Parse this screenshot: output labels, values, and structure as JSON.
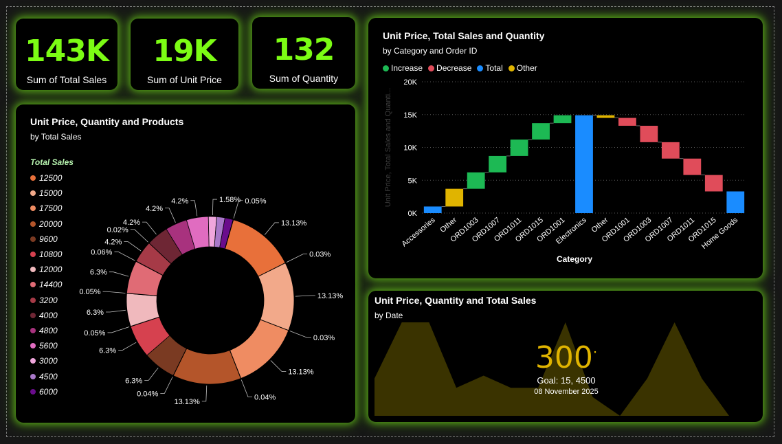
{
  "kpis": [
    {
      "value": "143K",
      "label": "Sum of Total Sales"
    },
    {
      "value": "19K",
      "label": "Sum of Unit Price"
    },
    {
      "value": "132",
      "label": "Sum of Quantity"
    }
  ],
  "colors": {
    "kpi_value": "#7cfc14",
    "glow": "#7cfc14",
    "increase": "#1db954",
    "decrease": "#e04c5a",
    "total": "#1a8cff",
    "other": "#e0b400"
  },
  "donut": {
    "title": "Unit Price, Quantity and Products",
    "subtitle": "by Total Sales",
    "legend_title": "Total Sales"
  },
  "waterfall": {
    "title": "Unit Price, Total Sales and Quantity",
    "subtitle": "by Category and Order ID",
    "legend": [
      {
        "name": "Increase",
        "color": "#1db954"
      },
      {
        "name": "Decrease",
        "color": "#e04c5a"
      },
      {
        "name": "Total",
        "color": "#1a8cff"
      },
      {
        "name": "Other",
        "color": "#e0b400"
      }
    ]
  },
  "area_card": {
    "title": "Unit Price, Quantity and Total Sales",
    "subtitle": "by Date",
    "gauge_value": "300",
    "goal_text": "Goal: 15, 4500",
    "date_text": "08 November 2025"
  },
  "chart_data": [
    {
      "type": "pie",
      "variant": "donut",
      "legend_title": "Total Sales",
      "legend_placement": "left",
      "legend_entries": [
        {
          "label": "12500",
          "color": "#e8703a"
        },
        {
          "label": "15000",
          "color": "#f2a98a"
        },
        {
          "label": "17500",
          "color": "#ef8c62"
        },
        {
          "label": "20000",
          "color": "#b4552a"
        },
        {
          "label": "9600",
          "color": "#7a3a22"
        },
        {
          "label": "10800",
          "color": "#d6414f"
        },
        {
          "label": "12000",
          "color": "#f0b9bd"
        },
        {
          "label": "14400",
          "color": "#e06b75"
        },
        {
          "label": "3200",
          "color": "#a63a47"
        },
        {
          "label": "4000",
          "color": "#6e2634"
        },
        {
          "label": "4800",
          "color": "#a8327e"
        },
        {
          "label": "5600",
          "color": "#e06cc0"
        },
        {
          "label": "3000",
          "color": "#f0a6dc"
        },
        {
          "label": "4500",
          "color": "#a878c8"
        },
        {
          "label": "6000",
          "color": "#6a0c8c"
        }
      ],
      "slices": [
        {
          "category": "12500",
          "value": 13.13,
          "label": "13.13%",
          "color": "#e8703a"
        },
        {
          "category": "12500",
          "value": 0.03,
          "label": "0.03%",
          "color": "#e8703a"
        },
        {
          "category": "15000",
          "value": 13.13,
          "label": "13.13%",
          "color": "#f2a98a"
        },
        {
          "category": "15000",
          "value": 0.03,
          "label": "0.03%",
          "color": "#f2a98a"
        },
        {
          "category": "17500",
          "value": 13.13,
          "label": "13.13%",
          "color": "#ef8c62"
        },
        {
          "category": "17500",
          "value": 0.04,
          "label": "0.04%",
          "color": "#ef8c62"
        },
        {
          "category": "20000",
          "value": 13.13,
          "label": "13.13%",
          "color": "#b4552a"
        },
        {
          "category": "20000",
          "value": 0.04,
          "label": "0.04%",
          "color": "#b4552a"
        },
        {
          "category": "9600",
          "value": 6.3,
          "label": "6.3%",
          "color": "#7a3a22"
        },
        {
          "category": "10800",
          "value": 6.3,
          "label": "6.3%",
          "color": "#d6414f"
        },
        {
          "category": "10800",
          "value": 0.05,
          "label": "0.05%",
          "color": "#d6414f"
        },
        {
          "category": "12000",
          "value": 6.3,
          "label": "6.3%",
          "color": "#f0b9bd"
        },
        {
          "category": "12000",
          "value": 0.05,
          "label": "0.05%",
          "color": "#f0b9bd"
        },
        {
          "category": "14400",
          "value": 6.3,
          "label": "6.3%",
          "color": "#e06b75"
        },
        {
          "category": "14400",
          "value": 0.06,
          "label": "0.06%",
          "color": "#e06b75"
        },
        {
          "category": "3200",
          "value": 4.2,
          "label": "4.2%",
          "color": "#a63a47"
        },
        {
          "category": "3200",
          "value": 0.02,
          "label": "0.02%",
          "color": "#a63a47"
        },
        {
          "category": "4000",
          "value": 4.2,
          "label": "4.2%",
          "color": "#6e2634"
        },
        {
          "category": "4800",
          "value": 4.2,
          "label": "4.2%",
          "color": "#a8327e"
        },
        {
          "category": "5600",
          "value": 4.2,
          "label": "4.2%",
          "color": "#e06cc0"
        },
        {
          "category": "3000",
          "value": 1.58,
          "label": "1.58%",
          "color": "#f0a6dc"
        },
        {
          "category": "4500",
          "value": 1.58,
          "label": "",
          "color": "#a878c8"
        },
        {
          "category": "6000",
          "value": 1.58,
          "label": "",
          "color": "#6a0c8c"
        },
        {
          "category": "6000",
          "value": 0.05,
          "label": "0.05%",
          "color": "#6a0c8c"
        }
      ]
    },
    {
      "type": "bar",
      "variant": "waterfall",
      "xlabel": "Category",
      "ylabel": "Unit Price, Total Sales and Quanti...",
      "ylim": [
        0,
        20000
      ],
      "yticks": [
        "0K",
        "5K",
        "10K",
        "15K",
        "20K"
      ],
      "grid": true,
      "legend_placement": "top-left",
      "bars": [
        {
          "label": "Accessories",
          "start": 0,
          "end": 1000,
          "kind": "total"
        },
        {
          "label": "Other",
          "start": 1000,
          "end": 3700,
          "kind": "other"
        },
        {
          "label": "ORD1003",
          "start": 3700,
          "end": 6200,
          "kind": "increase"
        },
        {
          "label": "ORD1007",
          "start": 6200,
          "end": 8700,
          "kind": "increase"
        },
        {
          "label": "ORD1011",
          "start": 8700,
          "end": 11200,
          "kind": "increase"
        },
        {
          "label": "ORD1015",
          "start": 11200,
          "end": 13700,
          "kind": "increase"
        },
        {
          "label": "ORD1001",
          "start": 13700,
          "end": 14900,
          "kind": "increase"
        },
        {
          "label": "Electronics",
          "start": 0,
          "end": 14900,
          "kind": "total"
        },
        {
          "label": "Other",
          "start": 14900,
          "end": 14500,
          "kind": "other"
        },
        {
          "label": "ORD1001",
          "start": 14500,
          "end": 13300,
          "kind": "decrease"
        },
        {
          "label": "ORD1003",
          "start": 13300,
          "end": 10800,
          "kind": "decrease"
        },
        {
          "label": "ORD1007",
          "start": 10800,
          "end": 8300,
          "kind": "decrease"
        },
        {
          "label": "ORD1011",
          "start": 8300,
          "end": 5800,
          "kind": "decrease"
        },
        {
          "label": "ORD1015",
          "start": 5800,
          "end": 3300,
          "kind": "decrease"
        },
        {
          "label": "Home Goods",
          "start": 0,
          "end": 3300,
          "kind": "total"
        }
      ]
    },
    {
      "type": "area",
      "variant": "kpi-trend-background",
      "color": "#3a3300",
      "values": [
        0.4,
        1.0,
        1.0,
        0.3,
        0.43,
        0.3,
        0.3,
        1.0,
        0.2,
        0.0,
        0.4,
        1.0,
        0.4,
        0.0
      ]
    }
  ]
}
